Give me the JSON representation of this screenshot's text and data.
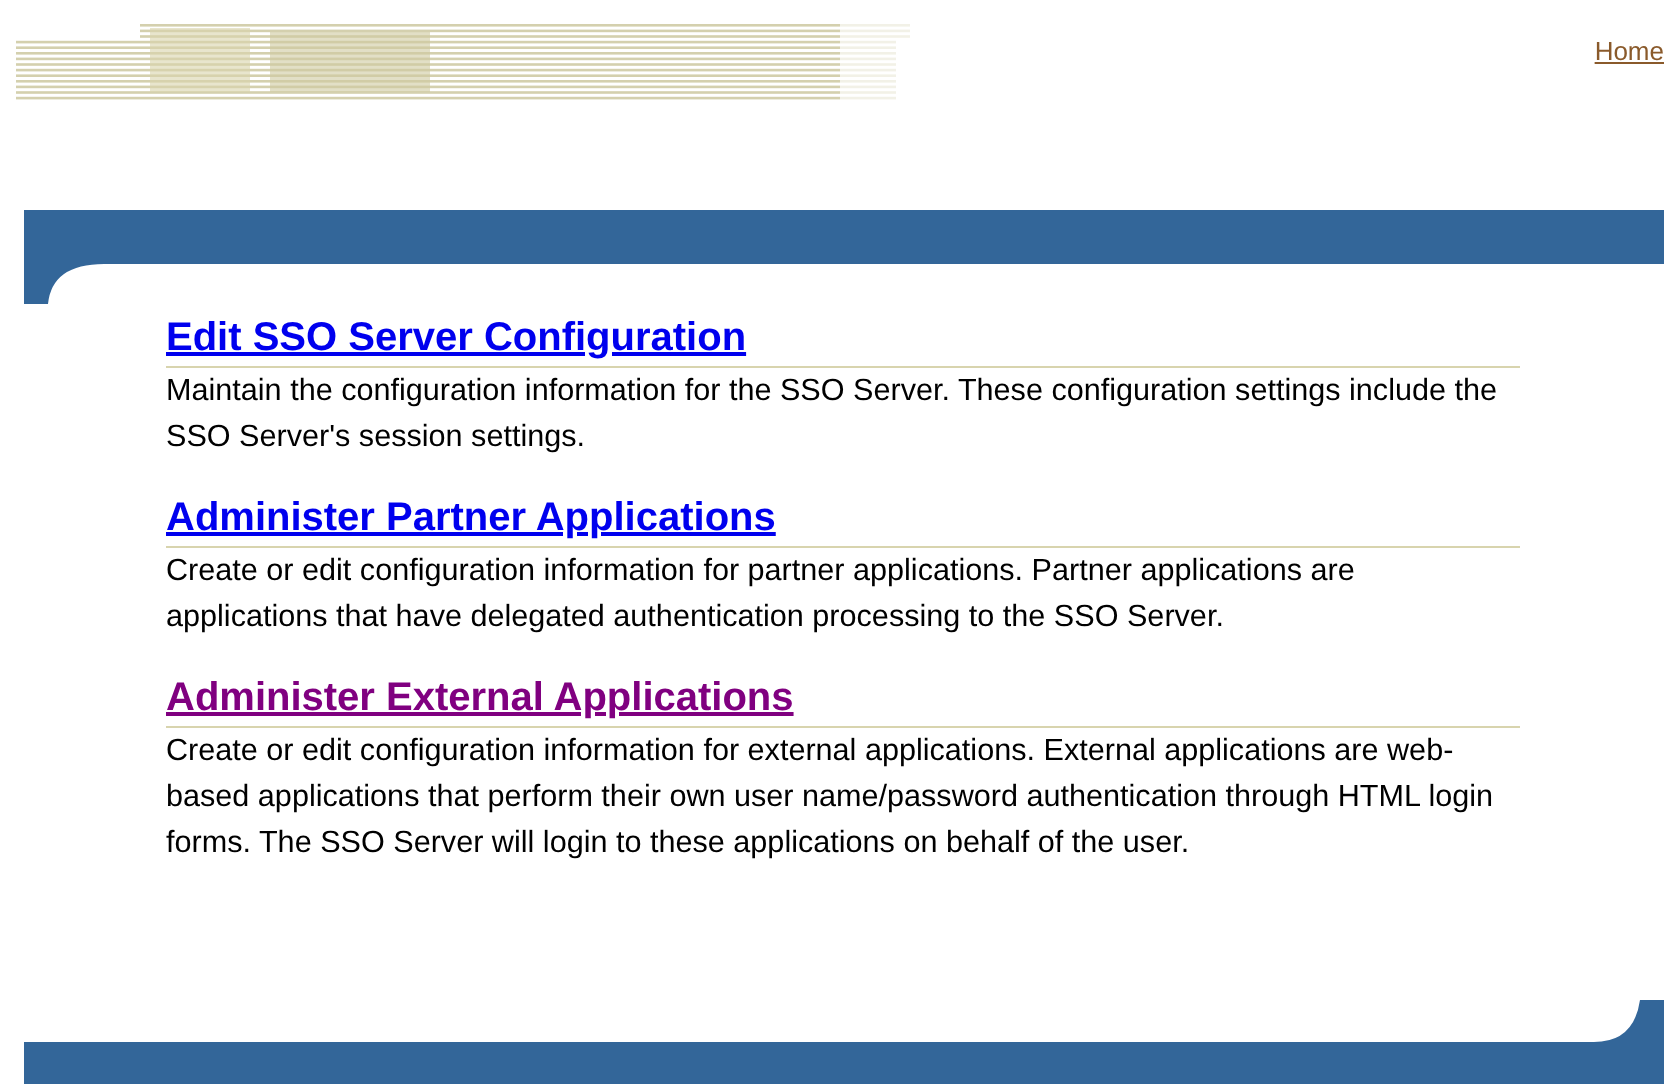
{
  "header": {
    "home_link": "Home"
  },
  "sections": [
    {
      "title": "Edit SSO Server Configuration",
      "visited": false,
      "description": "Maintain the configuration information for the SSO Server. These configuration settings include the SSO Server's session settings."
    },
    {
      "title": "Administer Partner Applications",
      "visited": false,
      "description": "Create or edit configuration information for partner applications. Partner applications are applications that have delegated authentication processing to the SSO Server."
    },
    {
      "title": "Administer External Applications",
      "visited": true,
      "description": "Create or edit configuration information for external applications. External applications are web-based applications that perform their own user name/password authentication through HTML login forms. The SSO Server will login to these applications on behalf of the user."
    }
  ]
}
